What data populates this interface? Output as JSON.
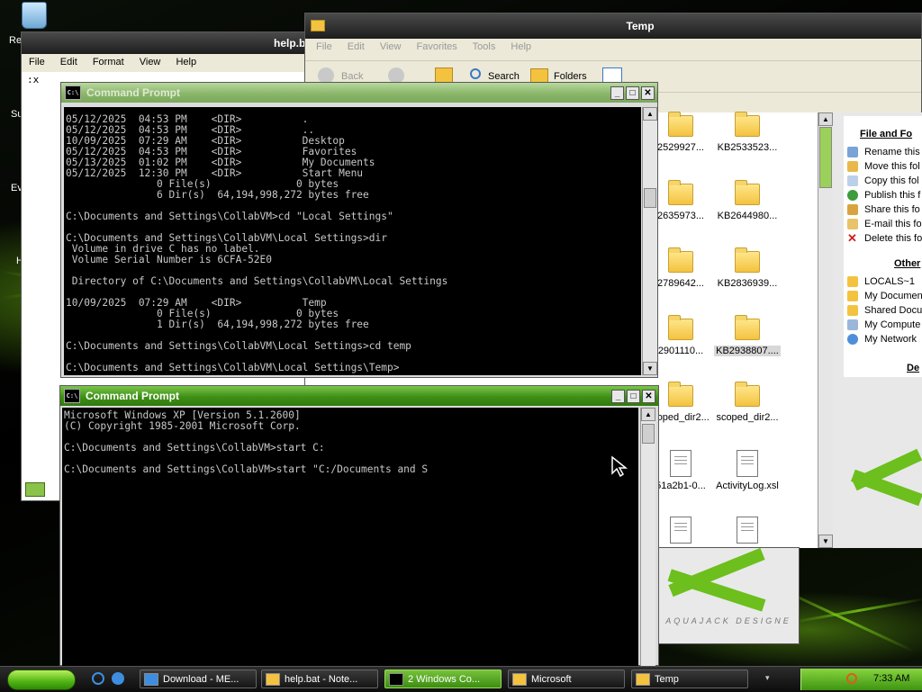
{
  "desktop": {
    "icon_labels": [
      "Re",
      "Su",
      "Ev",
      "H"
    ]
  },
  "notepad": {
    "title": "help.ba",
    "menu": [
      "File",
      "Edit",
      "Format",
      "View",
      "Help"
    ],
    "content": ":x"
  },
  "explorer": {
    "title": "Temp",
    "menu": [
      "File",
      "Edit",
      "View",
      "Favorites",
      "Tools",
      "Help"
    ],
    "toolbar": {
      "back": "Back",
      "search": "Search",
      "folders": "Folders"
    },
    "files": [
      {
        "name": "2529927...",
        "type": "folder"
      },
      {
        "name": "KB2533523...",
        "type": "folder"
      },
      {
        "name": "2635973...",
        "type": "folder"
      },
      {
        "name": "KB2644980...",
        "type": "folder"
      },
      {
        "name": "2789642...",
        "type": "folder"
      },
      {
        "name": "KB2836939...",
        "type": "folder"
      },
      {
        "name": "2901110...",
        "type": "folder"
      },
      {
        "name": "KB2938807....",
        "type": "folder",
        "selected": true
      },
      {
        "name": "coped_dir2...",
        "type": "folder"
      },
      {
        "name": "scoped_dir2...",
        "type": "folder"
      },
      {
        "name": "51a2b1-0...",
        "type": "file"
      },
      {
        "name": "ActivityLog.xsl",
        "type": "file"
      },
      {
        "name": "",
        "type": "doc"
      },
      {
        "name": "",
        "type": "doc"
      }
    ],
    "task_panel": {
      "file_heading": "File and Fo",
      "file_tasks": [
        "Rename this",
        "Move this fol",
        "Copy this fol",
        "Publish this f",
        "Share this fo",
        "E-mail this fo",
        "Delete this fo"
      ],
      "other_heading": "Other",
      "other_places": [
        "LOCALS~1",
        "My Documen",
        "Shared Docu",
        "My Compute",
        "My Network"
      ],
      "details_heading": "De"
    },
    "wallpaper_text": "AQUAJACK DESIGNE"
  },
  "cmd_back": {
    "title": "Command Prompt",
    "lines": [
      "05/12/2025  04:53 PM    <DIR>          .",
      "05/12/2025  04:53 PM    <DIR>          ..",
      "10/09/2025  07:29 AM    <DIR>          Desktop",
      "05/12/2025  04:53 PM    <DIR>          Favorites",
      "05/13/2025  01:02 PM    <DIR>          My Documents",
      "05/12/2025  12:30 PM    <DIR>          Start Menu",
      "               0 File(s)              0 bytes",
      "               6 Dir(s)  64,194,998,272 bytes free",
      "",
      "C:\\Documents and Settings\\CollabVM>cd \"Local Settings\"",
      "",
      "C:\\Documents and Settings\\CollabVM\\Local Settings>dir",
      " Volume in drive C has no label.",
      " Volume Serial Number is 6CFA-52E0",
      "",
      " Directory of C:\\Documents and Settings\\CollabVM\\Local Settings",
      "",
      "10/09/2025  07:29 AM    <DIR>          Temp",
      "               0 File(s)              0 bytes",
      "               1 Dir(s)  64,194,998,272 bytes free",
      "",
      "C:\\Documents and Settings\\CollabVM\\Local Settings>cd temp",
      "",
      "C:\\Documents and Settings\\CollabVM\\Local Settings\\Temp>"
    ]
  },
  "cmd_front": {
    "title": "Command Prompt",
    "lines": [
      "Microsoft Windows XP [Version 5.1.2600]",
      "(C) Copyright 1985-2001 Microsoft Corp.",
      "",
      "C:\\Documents and Settings\\CollabVM>start C:",
      "",
      "C:\\Documents and Settings\\CollabVM>start \"C:/Documents and S"
    ]
  },
  "taskbar": {
    "items": [
      {
        "label": "Download - ME...",
        "active": false
      },
      {
        "label": "help.bat - Note...",
        "active": false
      },
      {
        "label": "2 Windows Co...",
        "active": true
      },
      {
        "label": "Microsoft",
        "active": false
      },
      {
        "label": "Temp",
        "active": false
      }
    ],
    "clock": "7:33 AM"
  },
  "colors": {
    "accent_green": "#4fb313",
    "console_bg": "#000000",
    "console_text": "#c8c8c8"
  }
}
